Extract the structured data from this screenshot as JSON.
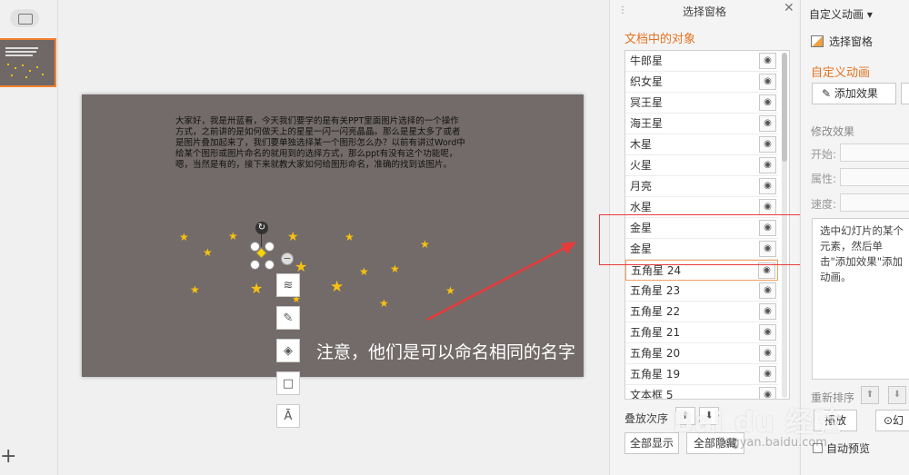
{
  "slide": {
    "body_text": "大家好，我是卅蓝看，今天我们要学的是有关PPT里面图片选择的一个操作方式，之前讲的是如何做天上的星星一闪一闪亮晶晶。那么是星太多了或者是图片叠加起来了，我们要单独选择某一个图形怎么办？以前有讲过Word中给某个图形或图片命名的就用到的选择方式，那么ppt有没有这个功能呢，嗯，当然是有的，接下来就教大家如何给图形命名，准确的找到该图片。",
    "annotation": "注意，他们是可以命名相同的名字",
    "accent_star": "#f7c111"
  },
  "selection_pane": {
    "title": "选择窗格",
    "subtitle": "文档中的对象",
    "items": [
      {
        "label": "牛郎星"
      },
      {
        "label": "织女星"
      },
      {
        "label": "冥王星"
      },
      {
        "label": "海王星"
      },
      {
        "label": "木星"
      },
      {
        "label": "火星"
      },
      {
        "label": "月亮"
      },
      {
        "label": "水星"
      },
      {
        "label": "金星"
      },
      {
        "label": "金星"
      },
      {
        "label": "五角星 24"
      },
      {
        "label": "五角星 23"
      },
      {
        "label": "五角星 22"
      },
      {
        "label": "五角星 21"
      },
      {
        "label": "五角星 20"
      },
      {
        "label": "五角星 19"
      },
      {
        "label": "文本框 5"
      }
    ],
    "order_label": "叠放次序",
    "show_all": "全部显示",
    "hide_all": "全部隐藏"
  },
  "animation_pane": {
    "title": "自定义动画",
    "select_pane_link": "选择窗格",
    "subtitle": "自定义动画",
    "add_effect": "添加效果",
    "modify_label": "修改效果",
    "start_label": "开始:",
    "property_label": "属性:",
    "speed_label": "速度:",
    "hint": "选中幻灯片的某个元素，然后单击\"添加效果\"添加动画。",
    "reorder_label": "重新排序",
    "play_label": "播放",
    "play2_label": "幻",
    "autopreview_label": "自动预览"
  },
  "watermark": {
    "text": "Bai du 经验",
    "sub": "jingyan.baidu.com"
  },
  "accent_color": "#e47221",
  "highlight_color": "#e83a3a"
}
